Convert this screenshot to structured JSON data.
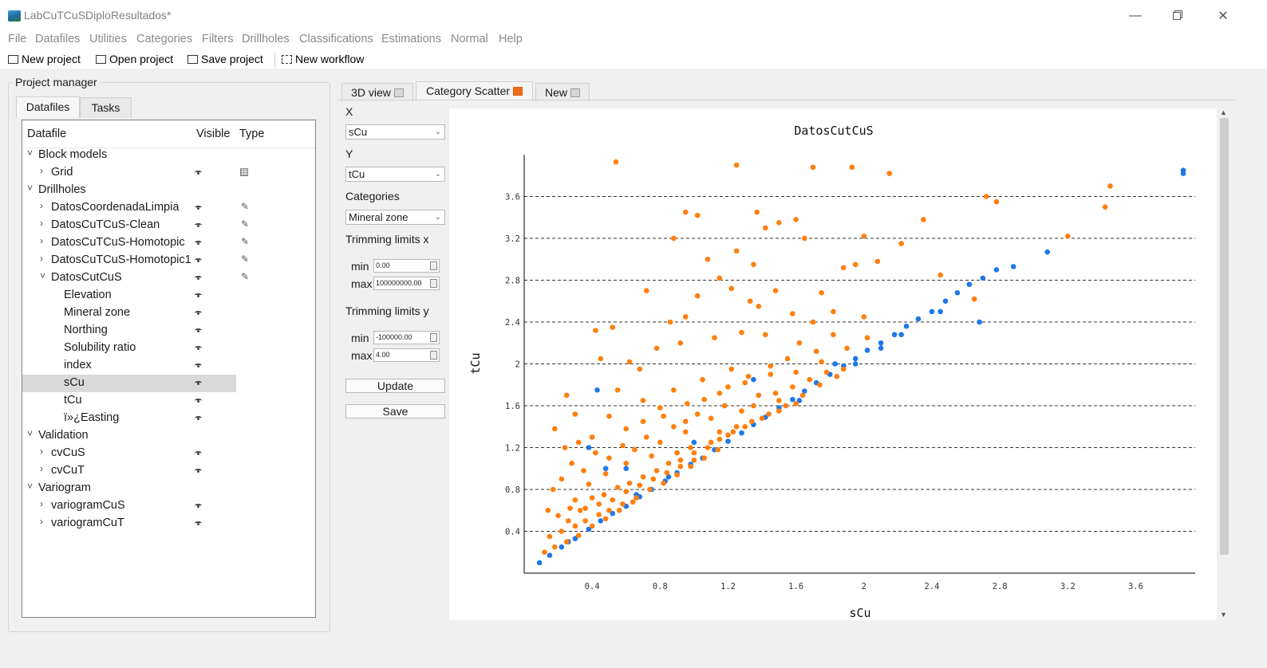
{
  "window": {
    "title": "LabCuTCuSDiploResultados*"
  },
  "menu": [
    "File",
    "Datafiles",
    "Utilities",
    "Categories",
    "Filters",
    "Drillholes",
    "Classifications",
    "Estimations",
    "Normal",
    "Help"
  ],
  "toolbar": {
    "new_project": "New project",
    "open_project": "Open project",
    "save_project": "Save project",
    "new_workflow": "New workflow"
  },
  "project_manager": {
    "title": "Project manager",
    "tabs": [
      "Datafiles",
      "Tasks"
    ],
    "columns": {
      "datafile": "Datafile",
      "visible": "Visible",
      "type": "Type"
    },
    "rows": [
      {
        "label": "Block models",
        "level": 0,
        "arrow": "˅",
        "eye": false,
        "type": ""
      },
      {
        "label": "Grid",
        "level": 1,
        "arrow": "›",
        "eye": true,
        "type": "grid-icon"
      },
      {
        "label": "Drillholes",
        "level": 0,
        "arrow": "˅",
        "eye": false,
        "type": ""
      },
      {
        "label": "DatosCoordenadaLimpia",
        "level": 1,
        "arrow": "›",
        "eye": true,
        "type": "pencil-icon"
      },
      {
        "label": "DatosCuTCuS-Clean",
        "level": 1,
        "arrow": "›",
        "eye": true,
        "type": "pencil-icon"
      },
      {
        "label": "DatosCuTCuS-Homotopic",
        "level": 1,
        "arrow": "›",
        "eye": true,
        "type": "pencil-icon"
      },
      {
        "label": "DatosCuTCuS-Homotopic1",
        "level": 1,
        "arrow": "›",
        "eye": true,
        "type": "pencil-icon"
      },
      {
        "label": "DatosCutCuS",
        "level": 1,
        "arrow": "˅",
        "eye": true,
        "type": "pencil-icon"
      },
      {
        "label": "Elevation",
        "level": 2,
        "arrow": "",
        "eye": true,
        "type": ""
      },
      {
        "label": "Mineral zone",
        "level": 2,
        "arrow": "",
        "eye": true,
        "type": ""
      },
      {
        "label": "Northing",
        "level": 2,
        "arrow": "",
        "eye": true,
        "type": ""
      },
      {
        "label": "Solubility ratio",
        "level": 2,
        "arrow": "",
        "eye": true,
        "type": ""
      },
      {
        "label": "index",
        "level": 2,
        "arrow": "",
        "eye": true,
        "type": ""
      },
      {
        "label": "sCu",
        "level": 2,
        "arrow": "",
        "eye": true,
        "type": "",
        "selected": true
      },
      {
        "label": "tCu",
        "level": 2,
        "arrow": "",
        "eye": true,
        "type": ""
      },
      {
        "label": "ï»¿Easting",
        "level": 2,
        "arrow": "",
        "eye": true,
        "type": ""
      },
      {
        "label": "Validation",
        "level": 0,
        "arrow": "˅",
        "eye": false,
        "type": ""
      },
      {
        "label": "cvCuS",
        "level": 1,
        "arrow": "›",
        "eye": true,
        "type": ""
      },
      {
        "label": "cvCuT",
        "level": 1,
        "arrow": "›",
        "eye": true,
        "type": ""
      },
      {
        "label": "Variogram",
        "level": 0,
        "arrow": "˅",
        "eye": false,
        "type": ""
      },
      {
        "label": "variogramCuS",
        "level": 1,
        "arrow": "›",
        "eye": true,
        "type": ""
      },
      {
        "label": "variogramCuT",
        "level": 1,
        "arrow": "›",
        "eye": true,
        "type": ""
      }
    ]
  },
  "view_tabs": [
    {
      "label": "3D view",
      "active": false,
      "close": "gray"
    },
    {
      "label": "Category Scatter",
      "active": true,
      "close": "orange"
    },
    {
      "label": "New",
      "active": false,
      "close": "gray"
    }
  ],
  "controls": {
    "x_label": "X",
    "x_value": "sCu",
    "y_label": "Y",
    "y_value": "tCu",
    "categories_label": "Categories",
    "categories_value": "Mineral zone",
    "trim_x_label": "Trimming limits x",
    "trim_x_min_label": "min",
    "trim_x_min": "0.00",
    "trim_x_max_label": "max",
    "trim_x_max": "100000000.00",
    "trim_y_label": "Trimming limits y",
    "trim_y_min_label": "min",
    "trim_y_min": "-100000.00",
    "trim_y_max_label": "max",
    "trim_y_max": "4.00",
    "update_button": "Update",
    "save_button": "Save"
  },
  "chart_data": {
    "type": "scatter",
    "title": "DatosCutCuS",
    "xlabel": "sCu",
    "ylabel": "tCu",
    "xlim": [
      0,
      3.95
    ],
    "ylim": [
      0,
      4.0
    ],
    "xticks": [
      "0.4",
      "0.8",
      "1.2",
      "1.6",
      "2",
      "2.4",
      "2.8",
      "3.2",
      "3.6"
    ],
    "yticks": [
      "0.4",
      "0.8",
      "1.2",
      "1.6",
      "2",
      "2.4",
      "2.8",
      "3.2",
      "3.6"
    ],
    "grid": "y-dashed",
    "series": [
      {
        "color": "#1f77e8",
        "points": [
          [
            0.09,
            0.1
          ],
          [
            0.15,
            0.17
          ],
          [
            0.22,
            0.25
          ],
          [
            0.3,
            0.33
          ],
          [
            0.38,
            0.42
          ],
          [
            0.45,
            0.5
          ],
          [
            0.52,
            0.57
          ],
          [
            0.6,
            0.64
          ],
          [
            0.68,
            0.73
          ],
          [
            0.75,
            0.8
          ],
          [
            0.83,
            0.88
          ],
          [
            0.9,
            0.96
          ],
          [
            0.98,
            1.04
          ],
          [
            1.05,
            1.1
          ],
          [
            1.12,
            1.18
          ],
          [
            1.2,
            1.26
          ],
          [
            1.28,
            1.34
          ],
          [
            1.35,
            1.42
          ],
          [
            1.42,
            1.49
          ],
          [
            1.5,
            1.58
          ],
          [
            1.58,
            1.66
          ],
          [
            1.65,
            1.74
          ],
          [
            1.72,
            1.82
          ],
          [
            1.8,
            1.9
          ],
          [
            1.88,
            1.98
          ],
          [
            1.95,
            2.05
          ],
          [
            2.02,
            2.13
          ],
          [
            2.1,
            2.2
          ],
          [
            2.18,
            2.28
          ],
          [
            2.25,
            2.36
          ],
          [
            2.32,
            2.43
          ],
          [
            2.4,
            2.5
          ],
          [
            2.48,
            2.6
          ],
          [
            2.55,
            2.68
          ],
          [
            2.62,
            2.76
          ],
          [
            2.7,
            2.82
          ],
          [
            2.78,
            2.9
          ],
          [
            2.88,
            2.93
          ],
          [
            3.08,
            3.07
          ],
          [
            3.88,
            3.82
          ],
          [
            3.88,
            3.85
          ],
          [
            2.68,
            2.4
          ],
          [
            2.45,
            2.5
          ],
          [
            1.0,
            1.25
          ],
          [
            0.6,
            1.0
          ],
          [
            0.48,
            1.0
          ],
          [
            0.43,
            1.75
          ],
          [
            0.38,
            1.2
          ],
          [
            1.35,
            1.85
          ],
          [
            1.62,
            1.65
          ],
          [
            1.83,
            2.0
          ],
          [
            2.22,
            2.28
          ],
          [
            2.1,
            2.15
          ],
          [
            1.95,
            2.0
          ],
          [
            0.26,
            0.3
          ],
          [
            0.66,
            0.75
          ],
          [
            0.85,
            0.92
          ]
        ]
      },
      {
        "color": "#ff7f0e",
        "points": [
          [
            0.54,
            3.93
          ],
          [
            1.25,
            3.9
          ],
          [
            1.7,
            3.88
          ],
          [
            1.93,
            3.88
          ],
          [
            2.15,
            3.82
          ],
          [
            0.95,
            3.45
          ],
          [
            1.02,
            3.42
          ],
          [
            1.6,
            3.38
          ],
          [
            1.5,
            3.35
          ],
          [
            1.37,
            3.45
          ],
          [
            2.35,
            3.38
          ],
          [
            0.88,
            3.2
          ],
          [
            1.25,
            3.08
          ],
          [
            1.42,
            3.3
          ],
          [
            1.65,
            3.2
          ],
          [
            2.0,
            3.22
          ],
          [
            2.22,
            3.15
          ],
          [
            1.08,
            3.0
          ],
          [
            1.35,
            2.95
          ],
          [
            1.95,
            2.95
          ],
          [
            1.88,
            2.92
          ],
          [
            2.08,
            2.98
          ],
          [
            1.15,
            2.82
          ],
          [
            1.22,
            2.72
          ],
          [
            1.48,
            2.7
          ],
          [
            1.75,
            2.68
          ],
          [
            2.45,
            2.85
          ],
          [
            2.65,
            2.62
          ],
          [
            1.02,
            2.65
          ],
          [
            1.33,
            2.6
          ],
          [
            0.95,
            2.45
          ],
          [
            0.72,
            2.7
          ],
          [
            0.52,
            2.35
          ],
          [
            0.42,
            2.32
          ],
          [
            0.62,
            2.02
          ],
          [
            0.86,
            2.4
          ],
          [
            1.38,
            2.55
          ],
          [
            2.0,
            2.45
          ],
          [
            2.72,
            3.6
          ],
          [
            2.78,
            3.55
          ],
          [
            3.2,
            3.22
          ],
          [
            3.45,
            3.7
          ],
          [
            3.42,
            3.5
          ],
          [
            0.18,
            1.38
          ],
          [
            0.25,
            1.7
          ],
          [
            0.3,
            1.52
          ],
          [
            0.4,
            1.3
          ],
          [
            0.5,
            1.5
          ],
          [
            0.6,
            1.38
          ],
          [
            0.7,
            1.65
          ],
          [
            0.8,
            1.58
          ],
          [
            0.88,
            1.75
          ],
          [
            0.95,
            1.45
          ],
          [
            1.05,
            1.85
          ],
          [
            1.15,
            1.72
          ],
          [
            1.22,
            1.95
          ],
          [
            1.32,
            1.88
          ],
          [
            1.45,
            1.98
          ],
          [
            1.55,
            2.05
          ],
          [
            1.62,
            2.2
          ],
          [
            1.72,
            2.12
          ],
          [
            1.82,
            2.28
          ],
          [
            1.9,
            2.15
          ],
          [
            2.02,
            2.25
          ],
          [
            0.22,
            0.9
          ],
          [
            0.28,
            1.05
          ],
          [
            0.35,
            0.98
          ],
          [
            0.42,
            1.15
          ],
          [
            0.5,
            1.1
          ],
          [
            0.58,
            1.22
          ],
          [
            0.65,
            1.18
          ],
          [
            0.72,
            1.3
          ],
          [
            0.8,
            1.25
          ],
          [
            0.88,
            1.4
          ],
          [
            0.95,
            1.35
          ],
          [
            1.02,
            1.52
          ],
          [
            1.1,
            1.48
          ],
          [
            1.18,
            1.6
          ],
          [
            1.28,
            1.55
          ],
          [
            1.38,
            1.7
          ],
          [
            1.48,
            1.72
          ],
          [
            1.58,
            1.78
          ],
          [
            1.68,
            1.85
          ],
          [
            1.78,
            1.92
          ],
          [
            1.88,
            1.95
          ],
          [
            0.2,
            0.55
          ],
          [
            0.27,
            0.62
          ],
          [
            0.33,
            0.6
          ],
          [
            0.4,
            0.72
          ],
          [
            0.47,
            0.75
          ],
          [
            0.55,
            0.82
          ],
          [
            0.62,
            0.86
          ],
          [
            0.7,
            0.92
          ],
          [
            0.78,
            0.98
          ],
          [
            0.85,
            1.05
          ],
          [
            0.92,
            1.08
          ],
          [
            1.0,
            1.15
          ],
          [
            1.08,
            1.2
          ],
          [
            1.15,
            1.28
          ],
          [
            1.23,
            1.35
          ],
          [
            1.3,
            1.4
          ],
          [
            1.4,
            1.48
          ],
          [
            1.5,
            1.55
          ],
          [
            1.6,
            1.62
          ],
          [
            0.15,
            0.35
          ],
          [
            0.22,
            0.4
          ],
          [
            0.3,
            0.45
          ],
          [
            0.36,
            0.5
          ],
          [
            0.44,
            0.56
          ],
          [
            0.5,
            0.6
          ],
          [
            0.58,
            0.66
          ],
          [
            0.66,
            0.72
          ],
          [
            0.74,
            0.8
          ],
          [
            0.82,
            0.86
          ],
          [
            0.9,
            0.94
          ],
          [
            0.98,
            1.02
          ],
          [
            1.06,
            1.1
          ],
          [
            1.14,
            1.18
          ],
          [
            0.12,
            0.2
          ],
          [
            0.18,
            0.25
          ],
          [
            0.25,
            0.3
          ],
          [
            0.32,
            0.36
          ],
          [
            0.4,
            0.45
          ],
          [
            0.48,
            0.52
          ],
          [
            0.56,
            0.6
          ],
          [
            0.64,
            0.68
          ],
          [
            0.14,
            0.6
          ],
          [
            0.17,
            0.8
          ],
          [
            0.24,
            1.2
          ],
          [
            0.32,
            1.25
          ],
          [
            0.45,
            2.05
          ],
          [
            0.55,
            1.75
          ],
          [
            0.68,
            1.95
          ],
          [
            0.78,
            2.15
          ],
          [
            0.92,
            2.2
          ],
          [
            1.12,
            2.25
          ],
          [
            1.28,
            2.3
          ],
          [
            1.42,
            2.28
          ],
          [
            1.58,
            2.48
          ],
          [
            1.7,
            2.4
          ],
          [
            1.82,
            2.5
          ],
          [
            0.38,
            0.85
          ],
          [
            0.48,
            0.95
          ],
          [
            0.6,
            1.05
          ],
          [
            0.75,
            1.12
          ],
          [
            0.3,
            0.7
          ],
          [
            0.26,
            0.5
          ],
          [
            0.36,
            0.62
          ],
          [
            0.44,
            0.66
          ],
          [
            0.52,
            0.7
          ],
          [
            0.6,
            0.78
          ],
          [
            0.68,
            0.84
          ],
          [
            0.76,
            0.9
          ],
          [
            0.84,
            0.96
          ],
          [
            0.92,
            1.02
          ],
          [
            1.0,
            1.08
          ],
          [
            1.1,
            1.25
          ],
          [
            1.2,
            1.32
          ],
          [
            1.34,
            1.45
          ],
          [
            1.44,
            1.52
          ],
          [
            1.54,
            1.6
          ],
          [
            1.64,
            1.7
          ],
          [
            1.74,
            1.8
          ],
          [
            1.84,
            1.88
          ],
          [
            0.7,
            1.45
          ],
          [
            0.82,
            1.5
          ],
          [
            0.96,
            1.62
          ],
          [
            1.06,
            1.66
          ],
          [
            1.2,
            1.78
          ],
          [
            1.3,
            1.82
          ],
          [
            1.45,
            1.9
          ],
          [
            1.6,
            1.92
          ],
          [
            1.75,
            2.02
          ],
          [
            1.35,
            1.6
          ],
          [
            1.5,
            1.65
          ],
          [
            1.25,
            1.4
          ],
          [
            1.15,
            1.35
          ],
          [
            0.98,
            1.2
          ],
          [
            0.9,
            1.15
          ]
        ]
      }
    ]
  }
}
